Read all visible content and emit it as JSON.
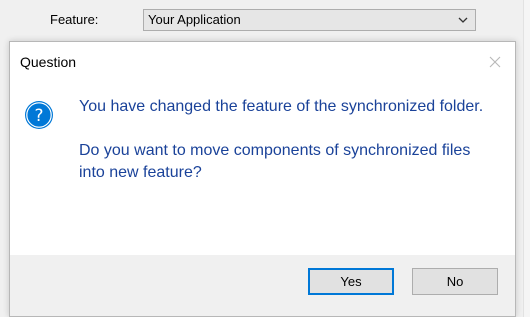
{
  "background_window": {
    "feature_label": "Feature:",
    "feature_value": "Your Application"
  },
  "dialog": {
    "title": "Question",
    "message_line1": "You have changed the feature of the synchronized folder.",
    "message_line2": "Do you want to move components of synchronized files into new feature?",
    "yes_label": "Yes",
    "no_label": "No"
  },
  "icons": {
    "question": "question-icon",
    "close": "close-icon",
    "dropdown": "chevron-down-icon"
  },
  "colors": {
    "message_text": "#1a4299",
    "icon_blue": "#0078d7",
    "default_button_border": "#0078d7"
  }
}
